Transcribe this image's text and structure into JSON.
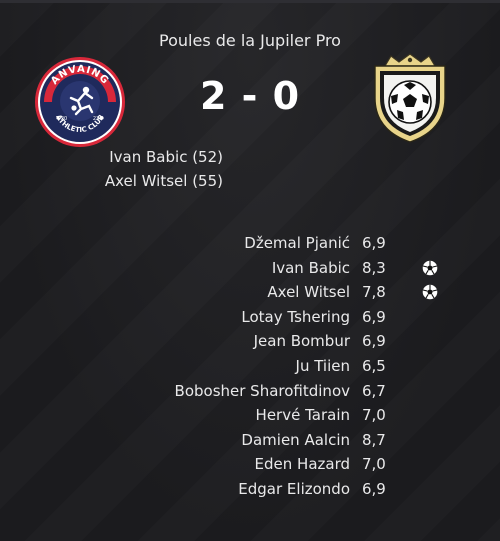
{
  "match": {
    "competition": "Poules de la Jupiler Pro",
    "score": "2 - 0",
    "home_badge": {
      "top_text": "ANVAING",
      "bottom_text": "ATHLETIC CLUB",
      "year_left": "20",
      "year_right": "23"
    },
    "away_badge_icon": "football-crest-icon"
  },
  "scorers": [
    "Ivan Babic (52)",
    "Axel Witsel (55)"
  ],
  "players": [
    {
      "name": "Džemal Pjanić",
      "rating": "6,9",
      "goal": false
    },
    {
      "name": "Ivan Babic",
      "rating": "8,3",
      "goal": true
    },
    {
      "name": "Axel Witsel",
      "rating": "7,8",
      "goal": true
    },
    {
      "name": "Lotay Tshering",
      "rating": "6,9",
      "goal": false
    },
    {
      "name": "Jean Bombur",
      "rating": "6,9",
      "goal": false
    },
    {
      "name": "Ju Tiien",
      "rating": "6,5",
      "goal": false
    },
    {
      "name": "Bobosher Sharofitdinov",
      "rating": "6,7",
      "goal": false
    },
    {
      "name": "Hervé Tarain",
      "rating": "7,0",
      "goal": false
    },
    {
      "name": "Damien Aalcin",
      "rating": "8,7",
      "goal": false
    },
    {
      "name": "Eden Hazard",
      "rating": "7,0",
      "goal": false
    },
    {
      "name": "Edgar Elizondo",
      "rating": "6,9",
      "goal": false
    }
  ],
  "colors": {
    "background": "#1d1d20",
    "home_navy": "#1f2a5c",
    "home_red": "#d8283a",
    "away_gold": "#c9b36a"
  }
}
